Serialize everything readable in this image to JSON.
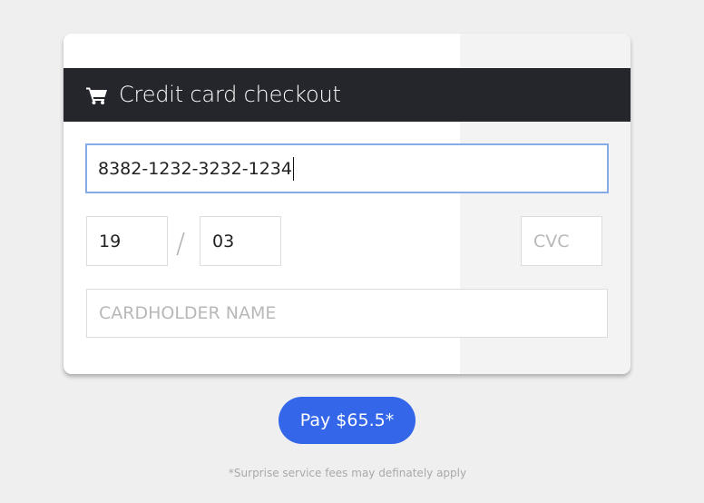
{
  "header": {
    "title": "Credit card checkout",
    "icon": "cart-icon"
  },
  "form": {
    "card_number": {
      "value": "8382-1232-3232-1234",
      "focused": true
    },
    "expiry_month": {
      "value": "19"
    },
    "expiry_separator": "/",
    "expiry_year": {
      "value": "03"
    },
    "cvc": {
      "value": "",
      "placeholder": "CVC"
    },
    "cardholder_name": {
      "value": "",
      "placeholder": "CARDHOLDER NAME"
    }
  },
  "pay_button": {
    "label": "Pay $65.5*"
  },
  "disclaimer": "*Surprise service fees may definately apply",
  "colors": {
    "page_background": "#efefef",
    "header_background": "#25262c",
    "accent": "#3366e8",
    "focus_border": "#86abe6",
    "card_stripe": "#f3f3f3"
  }
}
